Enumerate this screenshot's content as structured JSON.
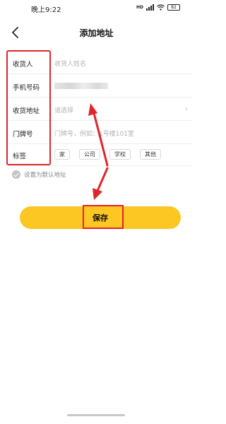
{
  "status_bar": {
    "time": "晚上9:22",
    "hd_label": "HD",
    "wifi_icon": "wifi-icon",
    "battery": "82"
  },
  "nav": {
    "title": "添加地址",
    "back_icon": "chevron-left-icon"
  },
  "form": {
    "receiver": {
      "label": "收货人",
      "placeholder": "收货人姓名"
    },
    "phone": {
      "label": "手机号码",
      "value_state": "blurred"
    },
    "address": {
      "label": "收货地址",
      "placeholder": "请选择",
      "chevron": "›"
    },
    "door": {
      "label": "门牌号",
      "placeholder": "门牌号，例如：1号楼101室"
    },
    "tags": {
      "label": "标签",
      "options": [
        "家",
        "公司",
        "学校",
        "其他"
      ]
    }
  },
  "default_address": {
    "label": "设置为默认地址",
    "icon": "check-circle-icon"
  },
  "save_button": {
    "label": "保存"
  },
  "colors": {
    "accent": "#fcc623",
    "annotation": "#e0252b",
    "placeholder": "#b3b3b3"
  }
}
